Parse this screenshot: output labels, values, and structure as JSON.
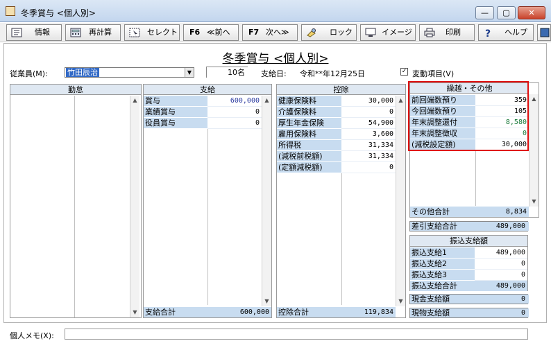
{
  "window": {
    "title": "冬季賞与 <個人別>",
    "min": "—",
    "max": "▢",
    "close": "✕"
  },
  "toolbar": {
    "info": "情報",
    "recalc": "再計算",
    "select": "セレクト",
    "f6": "F6",
    "prev": "≪前へ",
    "f7": "F7",
    "next": "次へ≫",
    "lock": "ロック",
    "image": "イメージ",
    "print": "印刷",
    "help": "ヘルプ"
  },
  "page_title": "冬季賞与 <個人別>",
  "header": {
    "employee_label": "従業員(M):",
    "employee_value": "竹田辰治",
    "count": "10名",
    "payday_label": "支給日:",
    "payday_value": "令和**年12月25日",
    "variable_check": "✓",
    "variable_label": "変動項目(V)"
  },
  "attendance": {
    "title": "勤怠"
  },
  "pay": {
    "title": "支給",
    "rows": [
      {
        "label": "賞与",
        "value": "600,000"
      },
      {
        "label": "業績賞与",
        "value": "0"
      },
      {
        "label": "役員賞与",
        "value": "0"
      }
    ],
    "total_label": "支給合計",
    "total_value": "600,000"
  },
  "deduction": {
    "title": "控除",
    "rows": [
      {
        "label": "健康保険料",
        "value": "30,000"
      },
      {
        "label": "介護保険料",
        "value": "0"
      },
      {
        "label": "厚生年金保険",
        "value": "54,900"
      },
      {
        "label": "雇用保険料",
        "value": "3,600"
      },
      {
        "label": "所得税",
        "value": "31,334"
      },
      {
        "label": "(減税前税額)",
        "value": "31,334"
      },
      {
        "label": "(定額減税額)",
        "value": "0"
      }
    ],
    "total_label": "控除合計",
    "total_value": "119,834"
  },
  "carryover": {
    "title": "繰越・その他",
    "rows": [
      {
        "label": "前回端数預り",
        "value": "359"
      },
      {
        "label": "今回端数預り",
        "value": "105"
      },
      {
        "label": "年末調整還付",
        "value": "8,580"
      },
      {
        "label": "年末調整徴収",
        "value": "0"
      },
      {
        "label": "(減税設定額)",
        "value": "30,000"
      }
    ],
    "total_label": "その他合計",
    "total_value": "8,834"
  },
  "net": {
    "label": "差引支給合計",
    "value": "489,000"
  },
  "transfer": {
    "title": "振込支給額",
    "rows": [
      {
        "label": "振込支給1",
        "value": "489,000"
      },
      {
        "label": "振込支給2",
        "value": "0"
      },
      {
        "label": "振込支給3",
        "value": "0"
      },
      {
        "label": "振込支給合計",
        "value": "489,000"
      }
    ]
  },
  "cash": {
    "label": "現金支給額",
    "value": "0"
  },
  "goods": {
    "label": "現物支給額",
    "value": "0"
  },
  "memo": {
    "label": "個人メモ(X):",
    "value": ""
  },
  "colors": {
    "highlight": "#e01010",
    "label_bg": "#c8dcf0",
    "select_bg": "#3169c6"
  }
}
